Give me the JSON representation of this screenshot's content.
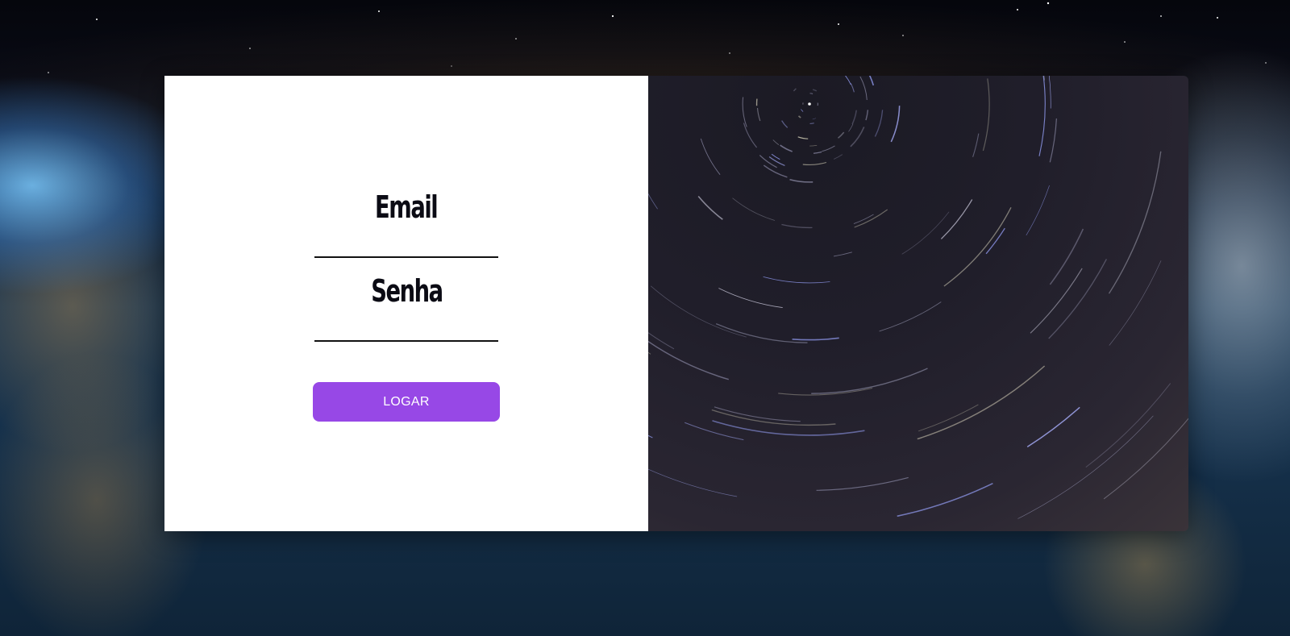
{
  "login_form": {
    "email_label": "Email",
    "email_value": "",
    "password_label": "Senha",
    "password_value": "",
    "submit_label": "LOGAR"
  },
  "colors": {
    "button_background": "#9748e6",
    "button_text": "#ffffff",
    "form_background": "#ffffff",
    "label_text": "#0b0b14"
  },
  "images": {
    "background": "earth-from-space-photo",
    "side_panel": "star-trails-photo"
  }
}
